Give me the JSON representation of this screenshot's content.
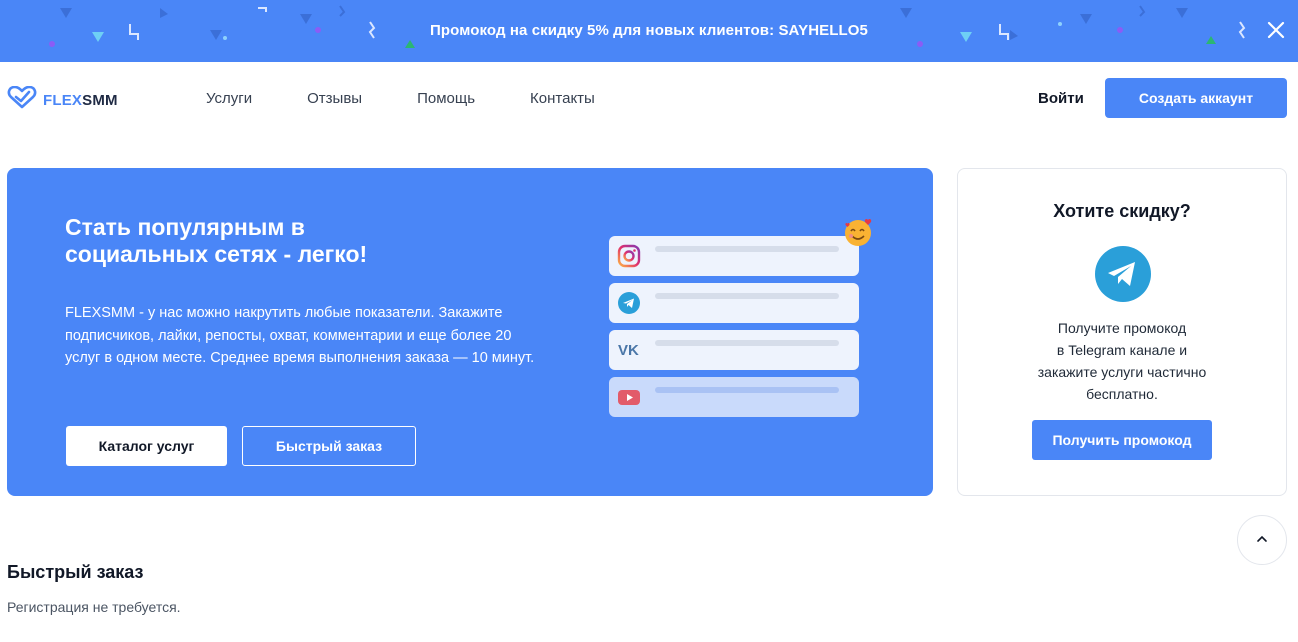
{
  "promo_banner": {
    "text": "Промокод на скидку 5% для новых клиентов: SAYHELLO5",
    "close_icon": "close-icon"
  },
  "header": {
    "logo": {
      "part1": "FLEX",
      "part2": "SMM",
      "icon": "heart-check-icon"
    },
    "nav": [
      {
        "label": "Услуги"
      },
      {
        "label": "Отзывы"
      },
      {
        "label": "Помощь"
      },
      {
        "label": "Контакты"
      }
    ],
    "login_label": "Войти",
    "signup_label": "Создать аккаунт"
  },
  "hero": {
    "title_line1": "Стать популярным в",
    "title_line2": "социальных сетях - легко!",
    "description": "FLEXSMM - у нас можно накрутить любые показатели. Закажите подписчиков, лайки, репосты, охват, комментарии и еще более 20 услуг в одном месте. Среднее время выполнения заказа — 10 минут.",
    "catalog_button": "Каталог услуг",
    "quick_order_button": "Быстрый заказ",
    "cards": [
      {
        "icon": "instagram-icon"
      },
      {
        "icon": "telegram-icon"
      },
      {
        "icon": "vk-icon"
      },
      {
        "icon": "youtube-icon"
      }
    ],
    "emoji_icon": "smiling-face-with-hearts-icon"
  },
  "discount": {
    "title": "Хотите скидку?",
    "icon": "telegram-icon",
    "line1": "Получите промокод",
    "line2": "в Telegram канале и",
    "line3": "закажите услуги частично",
    "line4": "бесплатно.",
    "button": "Получить промокод"
  },
  "scroll_top_icon": "chevron-up-icon",
  "quick_order": {
    "title": "Быстрый заказ",
    "subtitle": "Регистрация не требуется."
  },
  "colors": {
    "brand": "#4a86f7",
    "text": "#111827"
  }
}
